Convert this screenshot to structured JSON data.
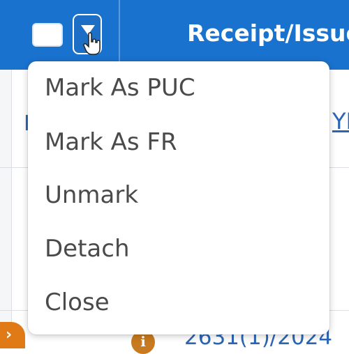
{
  "header": {
    "title": "Receipt/Issue"
  },
  "menu": {
    "items": [
      {
        "label": "Mark As PUC"
      },
      {
        "label": "Mark As FR"
      },
      {
        "label": "Unmark"
      },
      {
        "label": "Detach"
      },
      {
        "label": "Close"
      }
    ]
  },
  "background": {
    "left_peek": "I",
    "right_peek": "YE",
    "ref_number": "2631(1)/2024",
    "expand_glyph": "›",
    "info_glyph": "i"
  },
  "icons": {
    "dropdown": "filter-dropdown-icon",
    "cursor": "hand-pointer-icon",
    "info": "info-icon"
  },
  "colors": {
    "header_bg": "#1a72cf",
    "link": "#2b66b3",
    "accent_orange": "#e07a17"
  }
}
